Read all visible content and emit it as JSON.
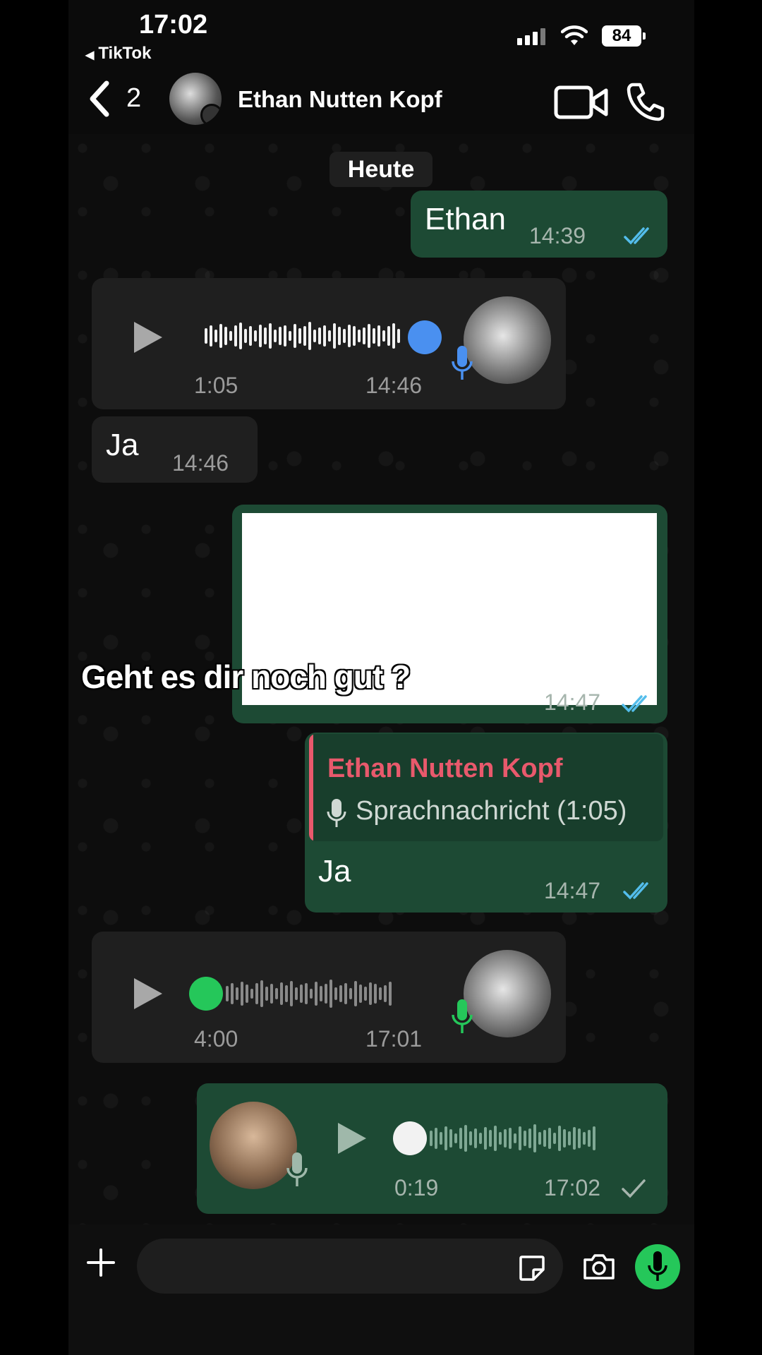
{
  "status_bar": {
    "time": "17:02",
    "back_app": "TikTok",
    "battery": "84"
  },
  "header": {
    "unread_count": "2",
    "contact_name": "Ethan Nutten Kopf"
  },
  "chat": {
    "date_chip": "Heute",
    "messages": [
      {
        "type": "text",
        "direction": "out",
        "text": "Ethan",
        "time": "14:39",
        "status": "read"
      },
      {
        "type": "voice",
        "direction": "in",
        "duration": "1:05",
        "time": "14:46",
        "progress": 1.0
      },
      {
        "type": "text",
        "direction": "in",
        "text": "Ja",
        "time": "14:46"
      },
      {
        "type": "image",
        "direction": "out",
        "time": "14:47",
        "status": "read"
      },
      {
        "type": "reply",
        "direction": "out",
        "quoted_name": "Ethan Nutten Kopf",
        "quoted_text": "Sprachnachricht (1:05)",
        "text": "Ja",
        "time": "14:47",
        "status": "read"
      },
      {
        "type": "voice",
        "direction": "in",
        "duration": "4:00",
        "time": "17:01",
        "progress": 0.0
      },
      {
        "type": "voice",
        "direction": "out",
        "duration": "0:19",
        "time": "17:02",
        "status": "sent",
        "progress": 0.0
      }
    ]
  },
  "overlay_caption": "Geht es dir noch gut ?",
  "colors": {
    "accent_green": "#25c75a",
    "outgoing_bubble": "#1d4a34",
    "incoming_bubble": "#1f1f1f",
    "read_ticks": "#53bdeb",
    "played_dot": "#4a90f0",
    "reply_name": "#e8596c"
  }
}
